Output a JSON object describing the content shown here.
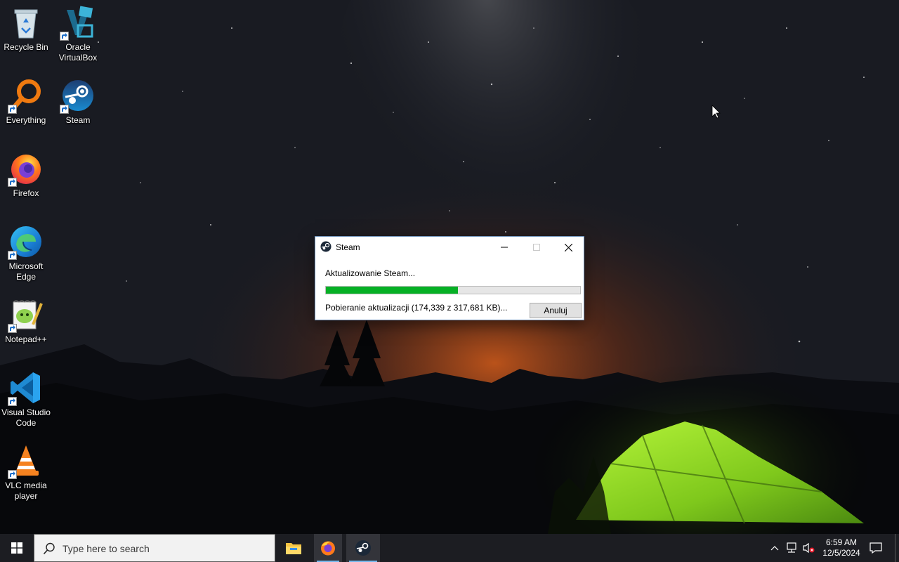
{
  "desktop": {
    "icons": [
      {
        "label": "Recycle Bin"
      },
      {
        "label": "Oracle VirtualBox"
      },
      {
        "label": "Everything"
      },
      {
        "label": "Steam"
      },
      {
        "label": "Firefox"
      },
      {
        "label": "Microsoft Edge"
      },
      {
        "label": "Notepad++"
      },
      {
        "label": "Visual Studio Code"
      },
      {
        "label": "VLC media player"
      }
    ]
  },
  "dialog": {
    "title": "Steam",
    "status": "Aktualizowanie Steam...",
    "progress_percent": 52,
    "detail": "Pobieranie aktualizacji (174,339 z 317,681 KB)...",
    "cancel_label": "Anuluj"
  },
  "taskbar": {
    "search_placeholder": "Type here to search",
    "apps": [
      "file-explorer",
      "firefox",
      "steam"
    ],
    "clock_time": "6:59 AM",
    "clock_date": "12/5/2024"
  },
  "colors": {
    "progress": "#06b025",
    "taskbar": "#1c1d22",
    "accent": "#76b9ed"
  }
}
